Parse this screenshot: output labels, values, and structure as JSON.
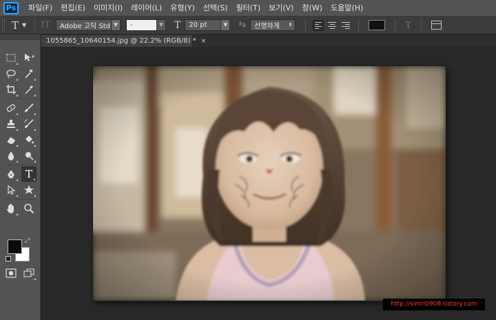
{
  "app": {
    "logo_text": "Ps",
    "menu": [
      "파일(F)",
      "편집(E)",
      "이미지(I)",
      "레이어(L)",
      "유형(Y)",
      "선택(S)",
      "필터(T)",
      "보기(V)",
      "창(W)",
      "도움말(H)"
    ]
  },
  "options_bar": {
    "tool_icon": "text-tool-icon",
    "font_family": "Adobe 고딕 Std",
    "font_style": "-",
    "font_size": "20 pt",
    "antialias": "선명하게",
    "alignment": "left",
    "text_color": "#111111"
  },
  "document": {
    "tab_title": "1055865_10640154.jpg @ 22.2% (RGB/8) *",
    "close_glyph": "×"
  },
  "toolbox": {
    "active_tool": "type-tool",
    "foreground_color": "#0a0a0a",
    "background_color": "#ffffff",
    "tools": [
      {
        "name": "marquee-tool",
        "icon": "marquee-icon"
      },
      {
        "name": "move-tool",
        "icon": "move-icon"
      },
      {
        "name": "lasso-tool",
        "icon": "lasso-icon"
      },
      {
        "name": "magic-wand-tool",
        "icon": "magic-wand-icon"
      },
      {
        "name": "crop-tool",
        "icon": "crop-icon"
      },
      {
        "name": "eyedropper-tool",
        "icon": "eyedropper-icon"
      },
      {
        "name": "healing-brush-tool",
        "icon": "healing-brush-icon"
      },
      {
        "name": "brush-tool",
        "icon": "brush-icon"
      },
      {
        "name": "clone-stamp-tool",
        "icon": "stamp-icon"
      },
      {
        "name": "history-brush-tool",
        "icon": "history-brush-icon"
      },
      {
        "name": "eraser-tool",
        "icon": "eraser-icon"
      },
      {
        "name": "paint-bucket-tool",
        "icon": "paint-bucket-icon"
      },
      {
        "name": "blur-tool",
        "icon": "blur-icon"
      },
      {
        "name": "dodge-tool",
        "icon": "dodge-icon"
      },
      {
        "name": "pen-tool",
        "icon": "pen-icon"
      },
      {
        "name": "type-tool",
        "icon": "type-icon"
      },
      {
        "name": "path-selection-tool",
        "icon": "path-selection-icon"
      },
      {
        "name": "shape-tool",
        "icon": "shape-icon"
      },
      {
        "name": "hand-tool",
        "icon": "hand-icon"
      },
      {
        "name": "zoom-tool",
        "icon": "zoom-icon"
      }
    ]
  },
  "canvas": {
    "subject": "photo"
  },
  "watermark": "http://simri0908.tistory.com"
}
